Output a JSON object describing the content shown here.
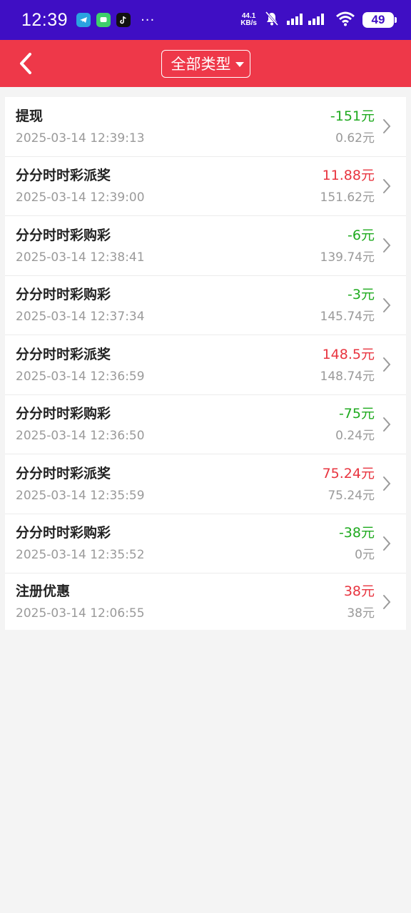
{
  "status_bar": {
    "time": "12:39",
    "net_speed_value": "44.1",
    "net_speed_unit": "KB/s",
    "battery": "49",
    "more": "···"
  },
  "header": {
    "filter_label": "全部类型"
  },
  "records": [
    {
      "title": "提现",
      "time": "2025-03-14 12:39:13",
      "amount": "-151元",
      "balance": "0.62元",
      "sign": "neg"
    },
    {
      "title": "分分时时彩派奖",
      "time": "2025-03-14 12:39:00",
      "amount": "11.88元",
      "balance": "151.62元",
      "sign": "pos"
    },
    {
      "title": "分分时时彩购彩",
      "time": "2025-03-14 12:38:41",
      "amount": "-6元",
      "balance": "139.74元",
      "sign": "neg"
    },
    {
      "title": "分分时时彩购彩",
      "time": "2025-03-14 12:37:34",
      "amount": "-3元",
      "balance": "145.74元",
      "sign": "neg"
    },
    {
      "title": "分分时时彩派奖",
      "time": "2025-03-14 12:36:59",
      "amount": "148.5元",
      "balance": "148.74元",
      "sign": "pos"
    },
    {
      "title": "分分时时彩购彩",
      "time": "2025-03-14 12:36:50",
      "amount": "-75元",
      "balance": "0.24元",
      "sign": "neg"
    },
    {
      "title": "分分时时彩派奖",
      "time": "2025-03-14 12:35:59",
      "amount": "75.24元",
      "balance": "75.24元",
      "sign": "pos"
    },
    {
      "title": "分分时时彩购彩",
      "time": "2025-03-14 12:35:52",
      "amount": "-38元",
      "balance": "0元",
      "sign": "neg"
    },
    {
      "title": "注册优惠",
      "time": "2025-03-14 12:06:55",
      "amount": "38元",
      "balance": "38元",
      "sign": "pos"
    }
  ],
  "colors": {
    "status_bar_bg": "#3f0ec4",
    "header_bg": "#ee3849",
    "negative_amount": "#1faa1f",
    "positive_amount": "#e8343f"
  }
}
